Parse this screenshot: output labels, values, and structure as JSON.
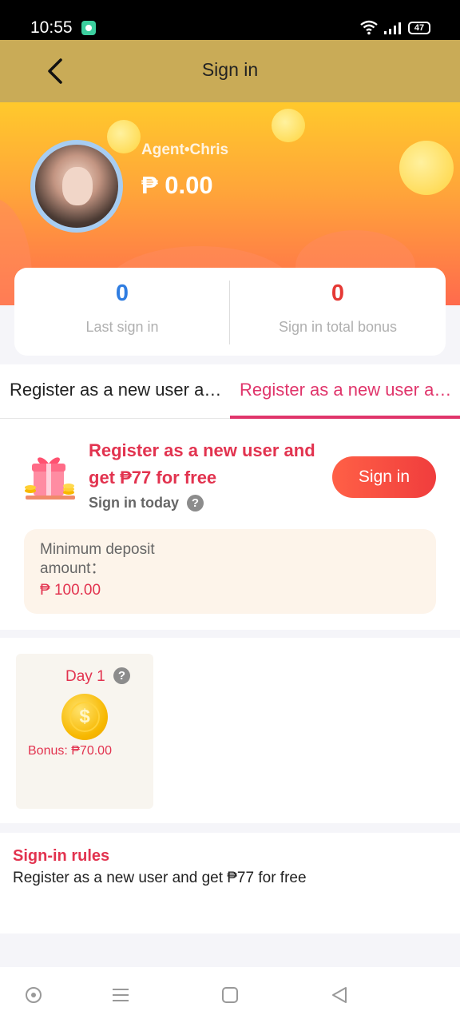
{
  "status_bar": {
    "time": "10:55",
    "battery": "47"
  },
  "header": {
    "title": "Sign in"
  },
  "profile": {
    "name": "Agent•Chris",
    "balance": "₱ 0.00"
  },
  "stats": {
    "last_sign_in": {
      "value": "0",
      "label": "Last sign in",
      "color": "#2f7de1"
    },
    "total_bonus": {
      "value": "0",
      "label": "Sign in total bonus",
      "color": "#e53935"
    }
  },
  "tabs": [
    {
      "label": "Register as a new user and get ₱77 for free",
      "active": false
    },
    {
      "label": "Register as a new user and get ₱77 for free",
      "active": true
    }
  ],
  "signin": {
    "promo_title": "Register as a new user and get ₱77 for free",
    "sign_today": "Sign in today",
    "button_label": "Sign in",
    "deposit_label": "Minimum deposit amount：",
    "deposit_value": "₱ 100.00"
  },
  "days": [
    {
      "label": "Day 1",
      "bonus": "Bonus: ₱70.00"
    }
  ],
  "rules": {
    "title": "Sign-in rules",
    "text": "Register as a new user and get ₱77 for free"
  },
  "colors": {
    "accent": "#e2334f",
    "nav": "#c9ab57"
  }
}
